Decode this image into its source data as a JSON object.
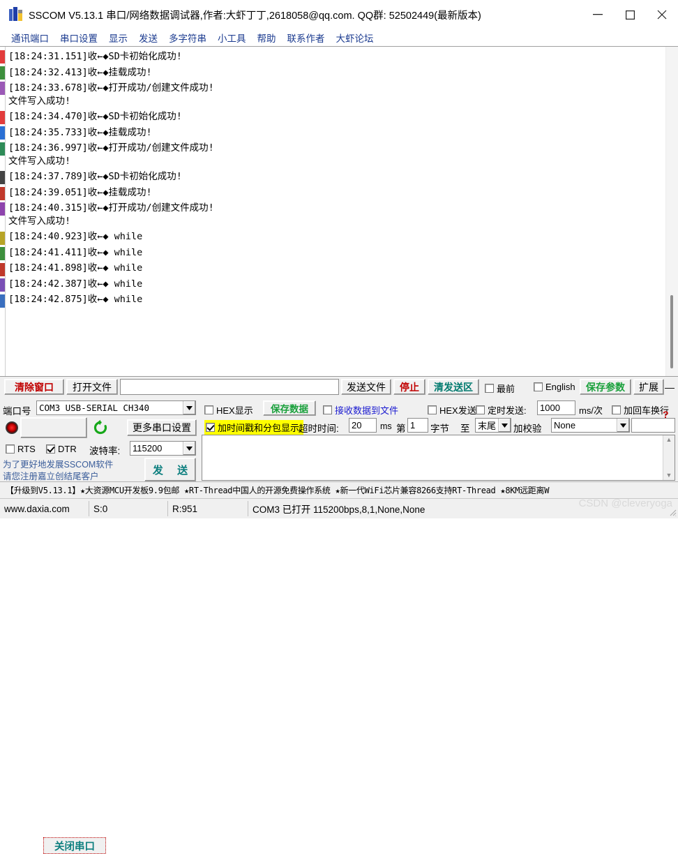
{
  "window": {
    "title": "SSCOM V5.13.1 串口/网络数据调试器,作者:大虾丁丁,2618058@qq.com. QQ群: 52502449(最新版本)",
    "icon": "sscom-app-icon",
    "minimize_label": "—",
    "maximize_label": "▢",
    "close_label": "✕"
  },
  "menu": {
    "items": [
      {
        "label": "通讯端口"
      },
      {
        "label": "串口设置"
      },
      {
        "label": "显示"
      },
      {
        "label": "发送"
      },
      {
        "label": "多字符串"
      },
      {
        "label": "小工具"
      },
      {
        "label": "帮助"
      },
      {
        "label": "联系作者"
      },
      {
        "label": "大虾论坛"
      }
    ]
  },
  "terminal": {
    "lines": [
      {
        "text": "[18:24:31.151]收←◆SD卡初始化成功!",
        "color": "#e23c3c",
        "cont": false
      },
      {
        "text": "[18:24:32.413]收←◆挂载成功!",
        "color": "#3d8f3d",
        "cont": false
      },
      {
        "text": "[18:24:33.678]收←◆打开成功/创建文件成功!",
        "color": "#9b59b6",
        "cont": false
      },
      {
        "text": "文件写入成功!",
        "color": "#9b59b6",
        "cont": true
      },
      {
        "text": "[18:24:34.470]收←◆SD卡初始化成功!",
        "color": "#e23c3c",
        "cont": false
      },
      {
        "text": "[18:24:35.733]收←◆挂载成功!",
        "color": "#2a6fd4",
        "cont": false
      },
      {
        "text": "[18:24:36.997]收←◆打开成功/创建文件成功!",
        "color": "#2e8b57",
        "cont": false
      },
      {
        "text": "文件写入成功!",
        "color": "#2e8b57",
        "cont": true
      },
      {
        "text": "[18:24:37.789]收←◆SD卡初始化成功!",
        "color": "#444444",
        "cont": false
      },
      {
        "text": "[18:24:39.051]收←◆挂载成功!",
        "color": "#c0392b",
        "cont": false
      },
      {
        "text": "[18:24:40.315]收←◆打开成功/创建文件成功!",
        "color": "#8e44ad",
        "cont": false
      },
      {
        "text": "文件写入成功!",
        "color": "#8e44ad",
        "cont": true
      },
      {
        "text": "[18:24:40.923]收←◆ while",
        "color": "#b7a427",
        "cont": false
      },
      {
        "text": "[18:24:41.411]收←◆ while",
        "color": "#3d8f3d",
        "cont": false
      },
      {
        "text": "[18:24:41.898]收←◆ while",
        "color": "#c0392b",
        "cont": false
      },
      {
        "text": "[18:24:42.387]收←◆ while",
        "color": "#7a4fb5",
        "cont": false
      },
      {
        "text": "[18:24:42.875]收←◆ while",
        "color": "#3a6fbf",
        "cont": false
      }
    ],
    "scrollbar": "vertical-scrollbar"
  },
  "toolbar": {
    "clear_window": "清除窗口",
    "open_file": "打开文件",
    "send_path_value": "",
    "send_file": "发送文件",
    "stop": "停止",
    "clear_send_area": "清发送区",
    "always_on_top": "最前",
    "english": "English",
    "save_params": "保存参数",
    "expand": "扩展",
    "collapse": "—"
  },
  "port_settings": {
    "port_label": "端口号",
    "port_value": "COM3 USB-SERIAL CH340",
    "close_port": "关闭串口",
    "refresh_icon": "refresh-icon",
    "led_icon": "status-led-icon",
    "more_settings": "更多串口设置",
    "rts": "RTS",
    "rts_checked": false,
    "dtr": "DTR",
    "dtr_checked": true,
    "baud_label": "波特率:",
    "baud_value": "115200",
    "promo_line1": "为了更好地发展SSCOM软件",
    "promo_line2": "请您注册嘉立创结尾客户",
    "send_button": "发 送"
  },
  "display_options": {
    "hex_display": "HEX显示",
    "hex_display_checked": false,
    "save_data": "保存数据",
    "recv_to_file": "接收数据到文件",
    "recv_to_file_checked": false,
    "hex_send": "HEX发送",
    "hex_send_checked": false,
    "timed_send": "定时发送:",
    "timed_send_checked": false,
    "interval_value": "1000",
    "interval_unit": "ms/次",
    "append_crlf": "加回车换行",
    "append_crlf_checked": false,
    "timestamp_label": "加时间戳和分包显示,",
    "timestamp_checked": true,
    "timeout_label": "超时时间:",
    "timeout_value": "20",
    "timeout_unit": "ms",
    "byte_prefix": "第",
    "byte_from_value": "1",
    "byte_label": "字节",
    "byte_to_label": "至",
    "byte_to_value": "末尾",
    "checksum_label": "加校验",
    "checksum_value": "None",
    "extra_value": "",
    "help_marker": "?"
  },
  "banner": {
    "text": "【升级到V5.13.1】★大资源MCU开发板9.9包邮 ★RT-Thread中国人的开源免费操作系统 ★新一代WiFi芯片兼容8266支持RT-Thread ★8KM远距离W"
  },
  "statusbar": {
    "website": "www.daxia.com",
    "sent": "S:0",
    "received": "R:951",
    "connection": "COM3 已打开  115200bps,8,1,None,None"
  },
  "watermark": {
    "text": "CSDN @cleveryoga"
  },
  "colors": {
    "accent_teal": "#0d7f7f",
    "accent_green": "#1aa03c",
    "accent_red": "#c00000",
    "menu_blue": "#1a3a8f",
    "highlight_yellow": "#ffff00"
  }
}
